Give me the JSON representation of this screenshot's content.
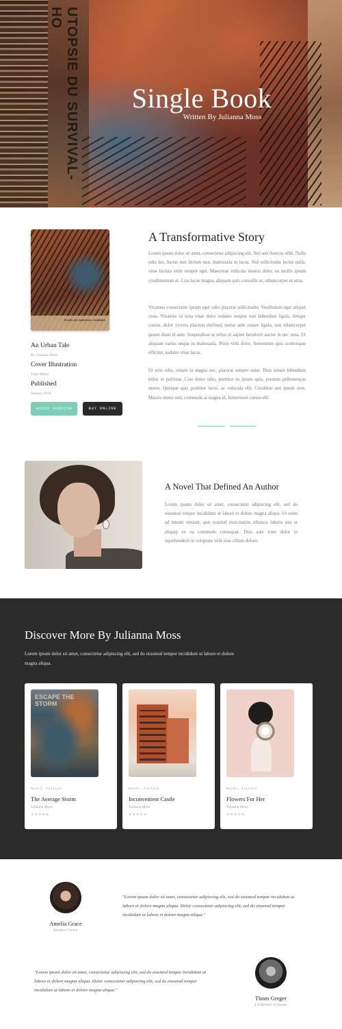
{
  "hero": {
    "title": "Single Book",
    "subtitle": "Written By Julianna Moss",
    "art_text": "UTOPSIE DU SURVIVAL-HO"
  },
  "book": {
    "cover_label": "POUR LES SURVIVAL HOMMES",
    "details": [
      {
        "title": "An Urban Tale",
        "sub": "By Julianna Moss"
      },
      {
        "title": "Cover Illustration",
        "sub": "Tony Miller"
      },
      {
        "title": "Published",
        "sub": "January 2018"
      }
    ],
    "buttons": {
      "audio": "AUDIO VERSION",
      "buy": "BUY ONLINE"
    }
  },
  "story": {
    "title": "A Transformative Story",
    "paragraphs": [
      "Lorem ipsum dolor sit amet, consectetur adipiscing elit. Sed sed rhoncus nibh. Nulla odio leo, luctus non dictum non, malesuada in lacus. Sed sollicitudin lectus nulla, vitae lacinia enim tempor eget. Maecenas vehicula mauris dolor, eu mollis ipsum condimentum et. Cras lacus magna, aliquam quis convallis ac, ullamcorper ut urna.",
      "Vivamus consectetur ipsum eget odio placerat sollicitudin. Vestibulum eget aliquet risus. Vivamus id urna vitae dolor sodales tempor non bibendum ligula. Integer cursus, dolor viverra placerat eleifend, metus ante ornare ligula, non ullamcorper ipsum diam id ante. Suspendisse at tellus ut sapien hendrerit auctor in nec urna. Ut aliquam varius neque in malesuada. Proin velit dolor, fermentum quis scelerisque efficitur, sodales vitae lacus.",
      "Ut eros odio, ornare in magna nec, placerat semper enim. Duis ornare bibendum tellus et pulvinar. Cras dolor odio, porttitor in ipsum quis, pretium pellentesque metus. Quisque quis porttitor lacus, ac vehicula elit. Curabitur sed ipsum eros. Mauris metus nisl, commodo at magna id, fermentum cursus elit."
    ]
  },
  "author": {
    "title": "A Novel That Defined An Author",
    "body": "Lorem ipsum dolor sit amet, consectetur adipiscing elit, sed do eiusmod tempor incididunt ut labore et dolore magna aliqua. Ut enim ad minim veniam, quis nostrud exercitation ullamco laboris nisi ut aliquip ex ea commodo consequat. Duis aute irure dolor in reprehenderit in voluptate velit esse cillum dolore."
  },
  "discover": {
    "title": "Discover More By Julianna Moss",
    "description": "Lorem ipsum dolor sit amet, consectetur adipiscing elit, sed do eiusmod tempor incididunt ut labore et dolore magna aliqua.",
    "books": [
      {
        "genre": "Novel, Fiction",
        "title": "The Average Storm",
        "author": "Julianna Moss",
        "stars": "★★★★★",
        "art_text": "ESCAPE THE STORM"
      },
      {
        "genre": "Novel, Fiction",
        "title": "Inconvenient Castle",
        "author": "Julianna Moss",
        "stars": "★★★★★"
      },
      {
        "genre": "Novel, Fiction",
        "title": "Flowers For Her",
        "author": "Julianna Moss",
        "stars": "★★★★★"
      }
    ]
  },
  "testimonials": [
    {
      "name": "Amelia Grace",
      "role": "Readers Choice",
      "quote": "\"Lorem ipsum dolor sit amet, consectetur adipiscing elit, sed do eiusmod tempor incididunt ut labore et dolore magna aliqua. Dolor consectetur adipiscing elit, sed do eiusmod tempor incididunt ut labore et dolore magna aliqua.\""
    },
    {
      "name": "Thom Greger",
      "role": "LA Review of Books",
      "quote": "\"Lorem ipsum dolor sit amet, consectetur adipiscing elit, sed do eiusmod tempor incididunt ut labore et dolore magna aliqua. Dolor consectetur adipiscing elit, sed do eiusmod tempor incididunt ut labore et dolore magna aliqua.\""
    }
  ],
  "colors": {
    "accent": "#7fcdb5",
    "dark": "#2b2b2b"
  }
}
